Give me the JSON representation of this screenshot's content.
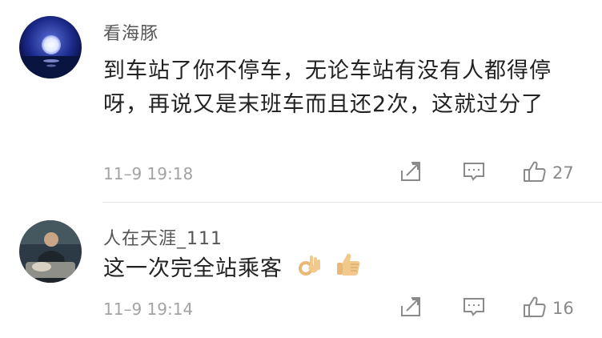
{
  "comments": [
    {
      "username": "看海豚",
      "text": "到车站了你不停车，无论车站有没有人都得停呀，再说又是末班车而且还2次，这就过分了",
      "time": "11–9 19:18",
      "likes": "27",
      "avatar": "moon-night-avatar"
    },
    {
      "username": "人在天涯_111",
      "text": "这一次完全站乘客",
      "emojis": [
        "ok-hand-emoji",
        "thumbs-up-emoji"
      ],
      "time": "11–9 19:14",
      "likes": "16",
      "avatar": "person-photo-avatar"
    }
  ],
  "icons": {
    "share": "share-icon",
    "reply": "comment-icon",
    "like": "thumbs-up-icon"
  },
  "colors": {
    "username": "#555555",
    "text": "#222222",
    "meta": "#a3a3a3",
    "icon": "#888888"
  }
}
